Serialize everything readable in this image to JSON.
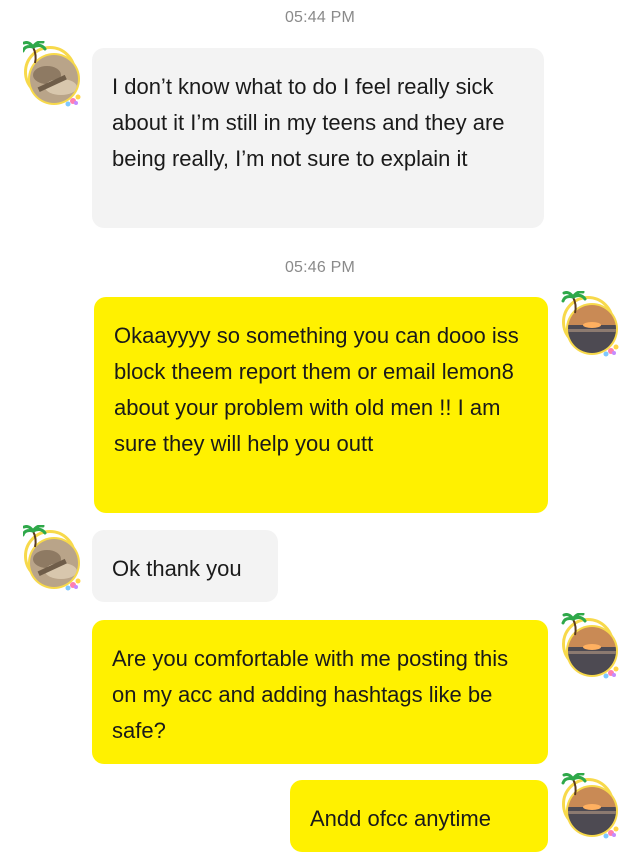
{
  "timestamps": [
    "05:44 PM",
    "05:46 PM"
  ],
  "messages": [
    {
      "direction": "incoming",
      "text": "I don’t know what to do I feel really sick about it I’m still in my teens and they are being really, I’m not sure to explain it"
    },
    {
      "direction": "outgoing",
      "text": "Okaayyyy so something you can dooo iss block theem report them or email lemon8 about your problem with old men !! I am sure they will help you outt"
    },
    {
      "direction": "incoming",
      "text": "Ok thank you"
    },
    {
      "direction": "outgoing",
      "text": "Are you comfortable with me posting this on my acc and adding hashtags like be safe?"
    },
    {
      "direction": "outgoing",
      "text": "Andd ofcc anytime"
    }
  ],
  "avatars": {
    "contact_icon": "contact-avatar-icon",
    "self_icon": "self-avatar-icon"
  },
  "colors": {
    "incoming_bubble": "#f3f3f3",
    "outgoing_bubble": "#fff100",
    "timestamp_text": "#8a8a8a",
    "avatar_ring": "#f7d94b"
  }
}
